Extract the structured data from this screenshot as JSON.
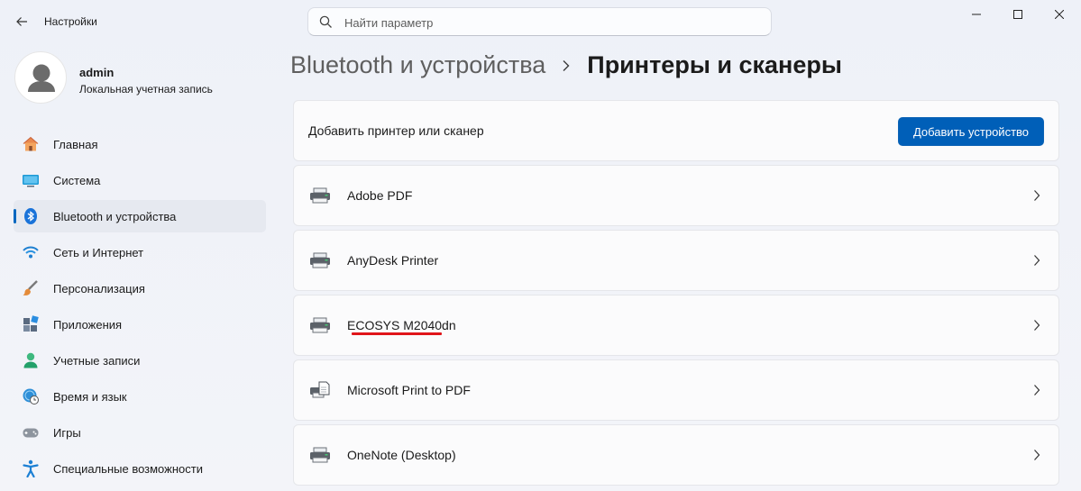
{
  "app": {
    "title": "Настройки"
  },
  "search": {
    "placeholder": "Найти параметр"
  },
  "user": {
    "name": "admin",
    "account_type": "Локальная учетная запись"
  },
  "nav": {
    "items": [
      {
        "label": "Главная",
        "icon": "home-icon"
      },
      {
        "label": "Система",
        "icon": "system-icon"
      },
      {
        "label": "Bluetooth и устройства",
        "icon": "bluetooth-icon",
        "active": true
      },
      {
        "label": "Сеть и Интернет",
        "icon": "wifi-icon"
      },
      {
        "label": "Персонализация",
        "icon": "brush-icon"
      },
      {
        "label": "Приложения",
        "icon": "apps-icon"
      },
      {
        "label": "Учетные записи",
        "icon": "account-icon"
      },
      {
        "label": "Время и язык",
        "icon": "globe-clock-icon"
      },
      {
        "label": "Игры",
        "icon": "gamepad-icon"
      },
      {
        "label": "Специальные возможности",
        "icon": "accessibility-icon"
      }
    ]
  },
  "breadcrumb": {
    "parent": "Bluetooth и устройства",
    "current": "Принтеры и сканеры"
  },
  "add_card": {
    "label": "Добавить принтер или сканер",
    "button": "Добавить устройство"
  },
  "printers": [
    {
      "name": "Adobe PDF",
      "icon": "printer-icon"
    },
    {
      "name": "AnyDesk Printer",
      "icon": "printer-icon"
    },
    {
      "name": "ECOSYS M2040dn",
      "icon": "printer-icon",
      "highlight_color": "#e0161a"
    },
    {
      "name": "Microsoft Print to PDF",
      "icon": "printer-document-icon"
    },
    {
      "name": "OneNote (Desktop)",
      "icon": "printer-icon"
    }
  ],
  "colors": {
    "accent": "#005fb8",
    "highlight": "#e0161a"
  }
}
